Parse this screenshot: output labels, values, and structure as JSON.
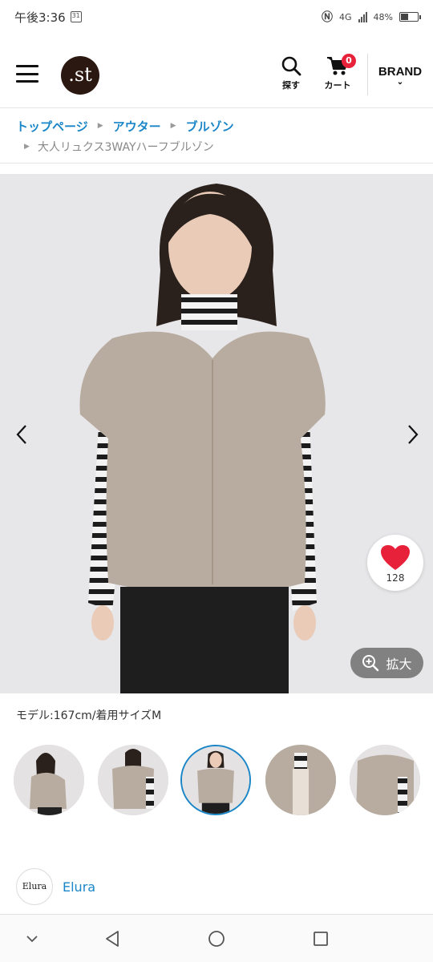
{
  "status_bar": {
    "time": "午後3:36",
    "calendar_day": "31",
    "network": "4G",
    "battery": "48%",
    "battery_level": 0.48
  },
  "header": {
    "logo_text": ".st",
    "search_label": "探す",
    "cart_label": "カート",
    "cart_count": "0",
    "brand_label": "BRAND"
  },
  "breadcrumb": {
    "items": [
      "トップページ",
      "アウター",
      "ブルゾン"
    ],
    "current": "大人リュクス3WAYハーフブルゾン"
  },
  "gallery": {
    "favorite_count": "128",
    "zoom_label": "拡大",
    "model_info": "モデル:167cm/着用サイズM",
    "thumbnail_count": 5,
    "active_thumbnail": 3
  },
  "brand": {
    "logo_text": "Elura",
    "name": "Elura"
  },
  "colors": {
    "accent": "#1a86c7",
    "badge": "#e8213a",
    "heart": "#e8213a",
    "logo_bg": "#2b1810"
  }
}
